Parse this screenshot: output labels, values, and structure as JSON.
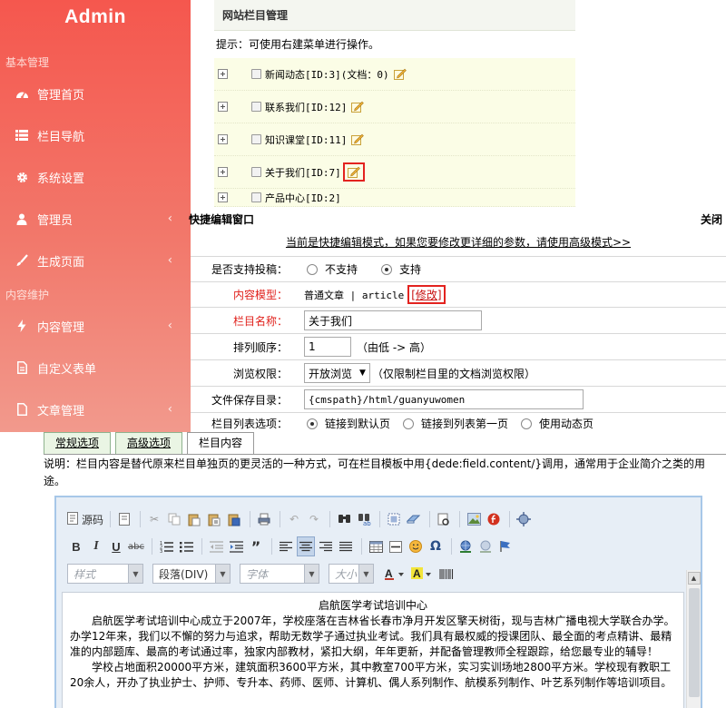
{
  "sidebar": {
    "brand": "Admin",
    "section1": "基本管理",
    "items1": [
      {
        "label": "管理首页",
        "icon": "dashboard-icon"
      },
      {
        "label": "栏目导航",
        "icon": "list-icon"
      },
      {
        "label": "系统设置",
        "icon": "gear-icon"
      },
      {
        "label": "管理员",
        "icon": "user-icon",
        "chevron": "‹"
      },
      {
        "label": "生成页面",
        "icon": "brush-icon",
        "chevron": "‹"
      }
    ],
    "section2": "内容维护",
    "items2": [
      {
        "label": "内容管理",
        "icon": "bolt-icon",
        "chevron": "‹"
      },
      {
        "label": "自定义表单",
        "icon": "document-icon"
      },
      {
        "label": "文章管理",
        "icon": "file-icon",
        "chevron": "‹"
      }
    ]
  },
  "category_panel": {
    "title": "网站栏目管理",
    "tip": "提示：可使用右建菜单进行操作。",
    "rows": [
      {
        "label": "新闻动态[ID:3](文档：0)"
      },
      {
        "label": "联系我们[ID:12]"
      },
      {
        "label": "知识课堂[ID:11]"
      },
      {
        "label": "关于我们[ID:7]"
      }
    ],
    "partial_row": "产品中心[ID:2]"
  },
  "quick_edit": {
    "title": "快捷编辑窗口",
    "close": "关闭",
    "notice": "当前是快捷编辑模式，如果您要修改更详细的参数，请使用高级模式>>",
    "fields": {
      "submit": {
        "label": "是否支持投稿：",
        "opt_no": "不支持",
        "opt_yes": "支持",
        "selected": "支持"
      },
      "model": {
        "label": "内容模型：",
        "value": "普通文章 | article",
        "modify": "[修改]"
      },
      "name": {
        "label": "栏目名称：",
        "value": "关于我们"
      },
      "order": {
        "label": "排列顺序：",
        "value": "1",
        "hint": "（由低 -> 高）"
      },
      "permission": {
        "label": "浏览权限：",
        "value": "开放浏览",
        "hint": "（仅限制栏目里的文档浏览权限）"
      },
      "dir": {
        "label": "文件保存目录：",
        "value": "{cmspath}/html/guanyuwomen"
      },
      "listopt": {
        "label": "栏目列表选项：",
        "opt1": "链接到默认页",
        "opt2": "链接到列表第一页",
        "opt3": "使用动态页"
      }
    }
  },
  "tabs": [
    {
      "label": "常规选项"
    },
    {
      "label": "高级选项"
    },
    {
      "label": "栏目内容"
    }
  ],
  "description": "说明：栏目内容是替代原来栏目单独页的更灵活的一种方式，可在栏目模板中用{dede:field.content/}调用，通常用于企业简介之类的用途。",
  "editor": {
    "source_label": "源码",
    "combos": {
      "style": "样式",
      "format": "段落(DIV)",
      "font": "字体",
      "size": "大小"
    },
    "content": {
      "heading": "启航医学考试培训中心",
      "p1": "启航医学考试培训中心成立于2007年，学校座落在吉林省长春市净月开发区擎天树街，现与吉林广播电视大学联合办学。",
      "p2": "办学12年来，我们以不懈的努力与追求，帮助无数学子通过执业考试。我们具有最权威的授课团队、最全面的考点精讲、最精准的内部题库、最高的考试通过率，独家内部教材，紧扣大纲，年年更新，并配备管理教师全程跟踪，给您最专业的辅导！",
      "p3": "学校占地面积20000平方米，建筑面积3600平方米，其中教室700平方米，实习实训场地2800平方米。学校现有教职工20余人，开办了执业护士、护师、专升本、药师、医师、计算机、偶人系列制作、航模系列制作、叶艺系列制作等培训项目。"
    }
  }
}
